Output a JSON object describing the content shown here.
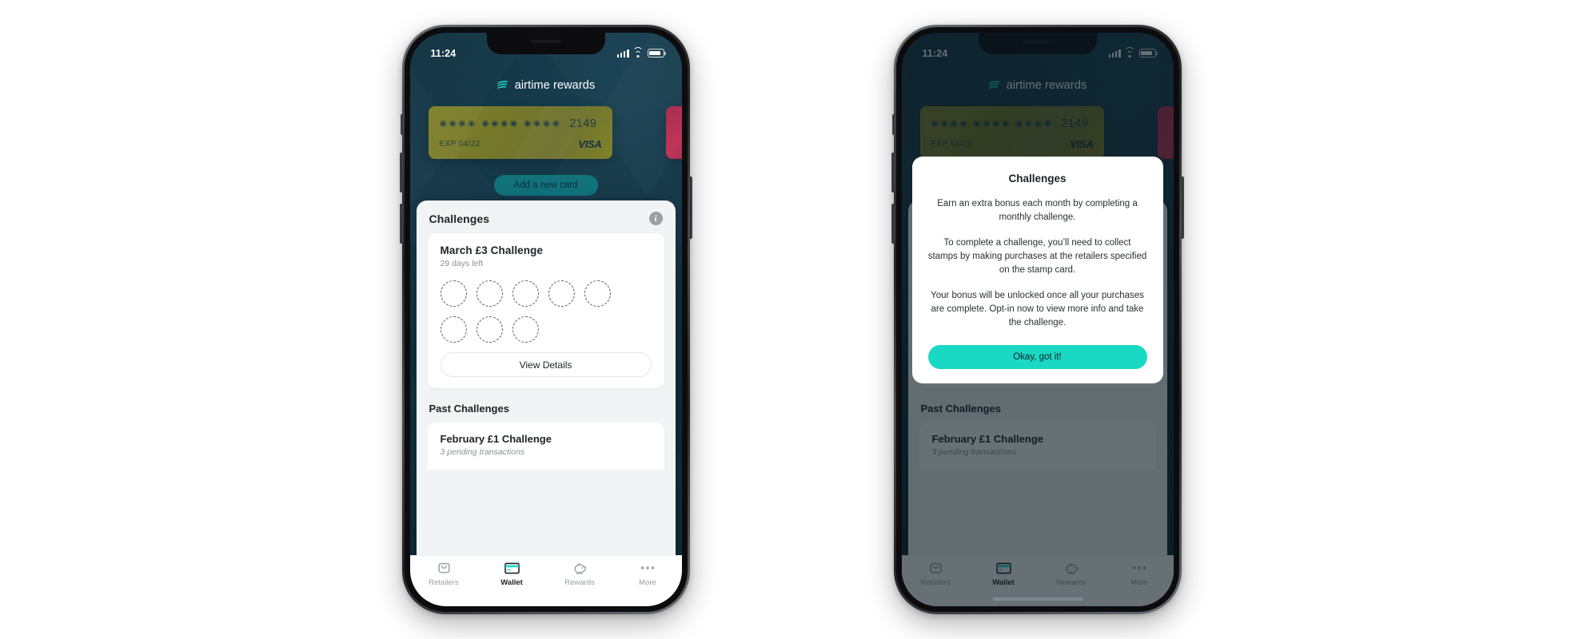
{
  "brand": {
    "name": "airtime rewards",
    "logo_icon": "airtime-waves-logo",
    "accent": "#1ad9c4"
  },
  "status_bar": {
    "time": "11:24",
    "signal_icon": "cellular-signal-icon",
    "wifi_icon": "wifi-icon",
    "battery_icon": "battery-icon"
  },
  "wallet": {
    "card": {
      "masked_digits": "✳✳✳✳  ✳✳✳✳  ✳✳✳✳",
      "last_four": "2149",
      "expiry": "EXP 04/22",
      "network": "VISA",
      "color": "#7a7c2b"
    },
    "next_card_color": "#b83256",
    "add_card_label": "Add a new card"
  },
  "challenges": {
    "section_title": "Challenges",
    "info_icon": "info-icon",
    "info_glyph": "i",
    "current": {
      "title": "March £3 Challenge",
      "days_left": "29 days left",
      "stamps_row1": 5,
      "stamps_row2": 3,
      "view_details_label": "View Details"
    },
    "past_section_title": "Past Challenges",
    "past": [
      {
        "title": "February £1 Challenge",
        "status": "3 pending transactions"
      }
    ]
  },
  "tabbar": {
    "items": [
      {
        "label": "Retailers",
        "icon": "shopping-bag-icon",
        "active": false
      },
      {
        "label": "Wallet",
        "icon": "credit-card-icon",
        "active": true
      },
      {
        "label": "Rewards",
        "icon": "piggy-bank-icon",
        "active": false
      },
      {
        "label": "More",
        "icon": "ellipsis-icon",
        "active": false
      }
    ]
  },
  "modal": {
    "title": "Challenges",
    "paragraph_1": "Earn an extra bonus each month by completing a monthly challenge.",
    "paragraph_2": "To complete a challenge, you’ll need to collect stamps by making purchases at the retailers specified on the stamp card.",
    "paragraph_3": "Your bonus will be unlocked once all your purchases are complete. Opt-in now to view more info and take the challenge.",
    "confirm_label": "Okay, got it!"
  }
}
